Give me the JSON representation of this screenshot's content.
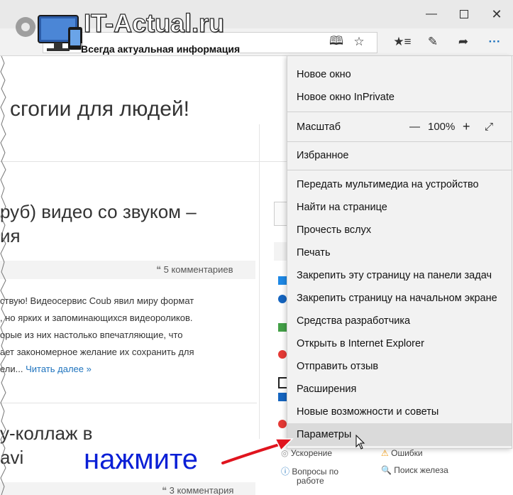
{
  "window": {
    "minimize_icon": "minimize-icon",
    "maximize_icon": "maximize-icon",
    "close_icon": "close-icon"
  },
  "logo": {
    "title": "IT-Actual.ru",
    "subtitle": "Всегда актуальная информация"
  },
  "toolbar": {
    "icons": [
      "reading-view-icon",
      "favorite-star-icon",
      "favorites-hub-icon",
      "web-note-icon",
      "share-icon",
      "more-icon"
    ],
    "more_label": "···"
  },
  "page": {
    "headline": "сгогии для людей!",
    "post1_title_line1": "руб) видео со звуком –",
    "post1_title_line2": "ия",
    "post1_comments": "5 комментариев",
    "post1_text": [
      "ствую! Видеосервис Coub явил миру формат",
      ", но ярких и запоминающихся видеороликов.",
      "орые из них настолько впечатляющие, что",
      "ает закономерное желание их сохранить для",
      "ели..."
    ],
    "read_more": "Читать далее »",
    "post2_title_line1": "у-коллаж в",
    "post2_title_line2": "avi",
    "post2_comments": "3 комментария",
    "sidebar_row1_left": "Ускорение",
    "sidebar_row1_right": "Ошибки",
    "sidebar_row2_left_line1": "Вопросы по",
    "sidebar_row2_left_line2": "работе",
    "sidebar_row2_right": "Поиск железа"
  },
  "menu": {
    "new_window": "Новое окно",
    "new_inprivate": "Новое окно InPrivate",
    "zoom_label": "Масштаб",
    "zoom_minus": "—",
    "zoom_value": "100%",
    "zoom_plus": "+",
    "favorites": "Избранное",
    "cast_media": "Передать мультимедиа на устройство",
    "find_on_page": "Найти на странице",
    "read_aloud": "Прочесть вслух",
    "print": "Печать",
    "pin_taskbar": "Закрепить эту страницу на панели задач",
    "pin_start": "Закрепить страницу на начальном экране",
    "dev_tools": "Средства разработчика",
    "open_ie": "Открыть в Internet Explorer",
    "send_feedback": "Отправить отзыв",
    "extensions": "Расширения",
    "whats_new": "Новые возможности и советы",
    "settings": "Параметры"
  },
  "annotation": {
    "text": "нажмите",
    "color": "#0a1fd6",
    "arrow_color": "#e0141e"
  }
}
